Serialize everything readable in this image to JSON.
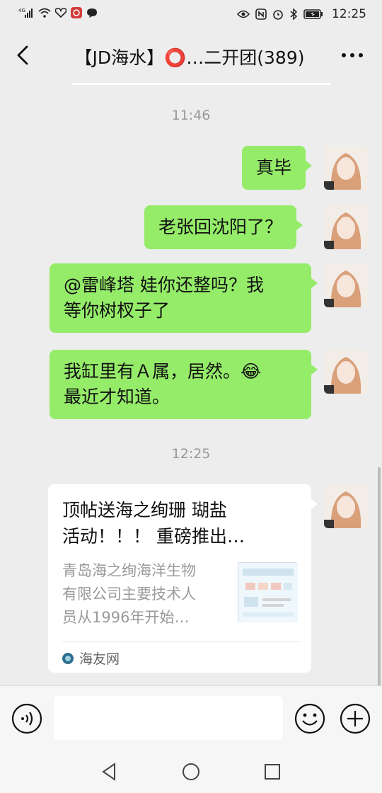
{
  "status_bar": {
    "network": "4G",
    "time": "12:25",
    "icons_left": [
      "signal-icon",
      "wifi-icon",
      "heart-app-icon",
      "red-app-icon",
      "chat-bubble-icon"
    ],
    "icons_right": [
      "eye-icon",
      "nfc-icon",
      "alarm-icon",
      "bluetooth-icon",
      "battery-icon"
    ]
  },
  "header": {
    "title": "【JD海水】⭕…二开团(389)"
  },
  "messages": [
    {
      "type": "timestamp",
      "text": "11:46"
    },
    {
      "type": "text",
      "sender": "self",
      "text": "真毕"
    },
    {
      "type": "text",
      "sender": "self",
      "text": "老张回沈阳了？"
    },
    {
      "type": "text",
      "sender": "self",
      "lines": [
        "@雷峰塔  娃你还整吗？我",
        "等你树杈子了"
      ]
    },
    {
      "type": "text",
      "sender": "self",
      "lines": [
        "我缸里有Ａ属，居然。😂",
        "最近才知道。"
      ]
    },
    {
      "type": "timestamp",
      "text": "12:25"
    },
    {
      "type": "link_card",
      "sender": "self",
      "title_lines": [
        "顶帖送海之绚珊 瑚盐",
        "活动！！！ 重磅推出…"
      ],
      "desc_lines": [
        "青岛海之绚海洋生物",
        "有限公司主要技术人",
        "员从1996年开始…"
      ],
      "source": "海友网"
    }
  ],
  "input_bar": {
    "text_value": "",
    "voice_icon": "voice-icon",
    "emoji_icon": "emoji-icon",
    "plus_icon": "plus-icon"
  },
  "nav_bar": {
    "icons": [
      "back-triangle-icon",
      "home-circle-icon",
      "recents-square-icon"
    ]
  },
  "colors": {
    "bubble_self": "#95ec69",
    "background": "#ededed",
    "card": "#ffffff"
  }
}
